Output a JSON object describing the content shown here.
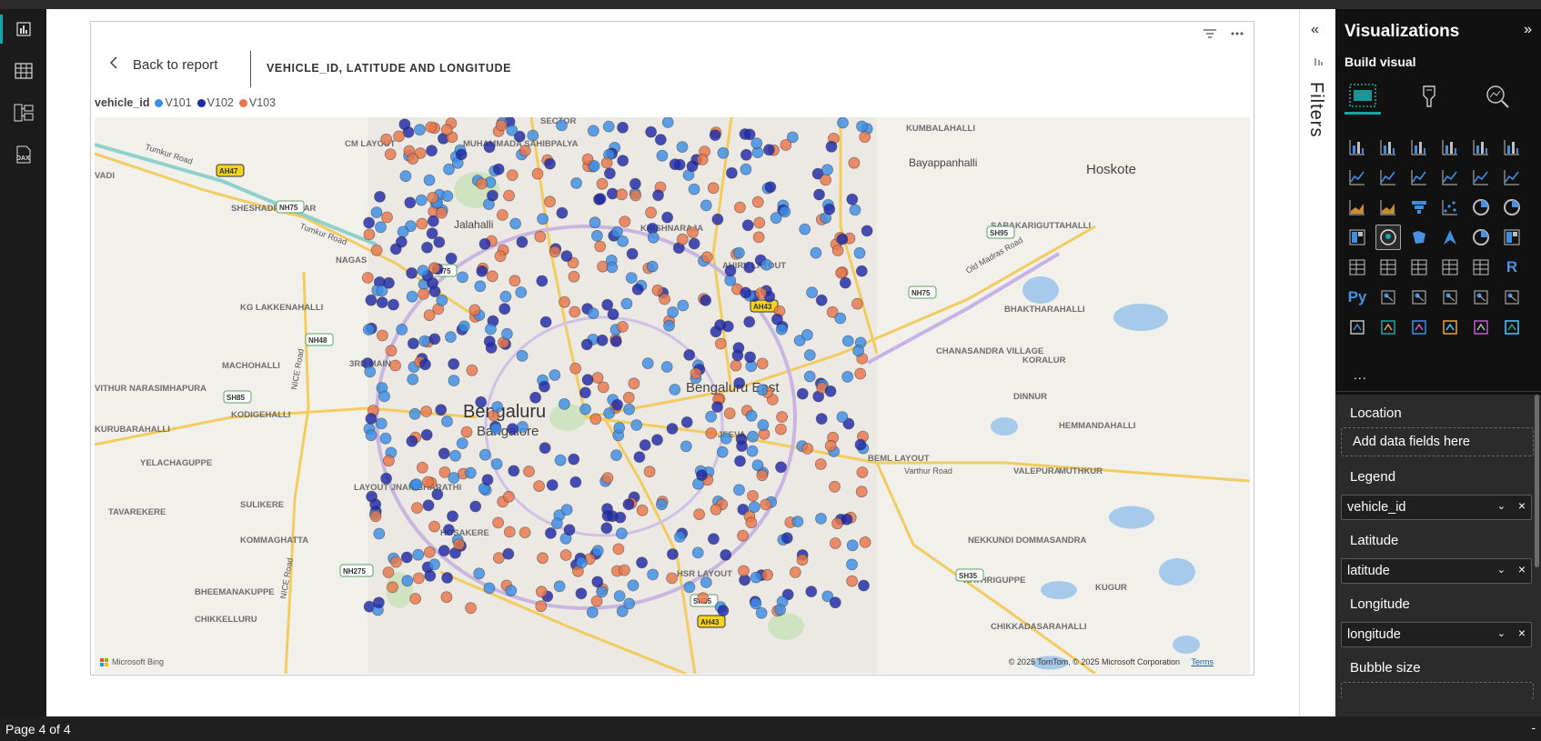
{
  "nav": {
    "items": [
      "report-view",
      "table-view",
      "model-view",
      "dax-query-view"
    ],
    "active": "report-view"
  },
  "visual": {
    "back_label": "Back to report",
    "title": "VEHICLE_ID, LATITUDE AND LONGITUDE",
    "legend_title": "vehicle_id",
    "legend": [
      {
        "label": "V101",
        "color": "#3c8de6"
      },
      {
        "label": "V102",
        "color": "#1f2aa8"
      },
      {
        "label": "V103",
        "color": "#e8764a"
      }
    ],
    "attribution": "© 2025 TomTom, © 2025 Microsoft Corporation",
    "terms": "Terms",
    "bing": "Microsoft Bing"
  },
  "map_labels": [
    {
      "text": "Bengaluru",
      "size": "big"
    },
    {
      "text": "Bangalore",
      "size": "med"
    },
    {
      "text": "Bengaluru East",
      "size": "med"
    },
    {
      "text": "Hoskote",
      "size": "med"
    },
    {
      "text": "Bayappanhalli",
      "size": "sm"
    },
    {
      "text": "Tumkur Road",
      "size": "xs"
    },
    {
      "text": "Tumkur Road",
      "size": "xs"
    },
    {
      "text": "Old Madras Road",
      "size": "xs"
    },
    {
      "text": "Varthur Road",
      "size": "xs"
    },
    {
      "text": "NICE Road",
      "size": "xs"
    },
    {
      "text": "NICE Road",
      "size": "xs"
    },
    {
      "text": "KUMBALAHALLI",
      "size": "caps"
    },
    {
      "text": "SARAKARIGUTTAHALLI",
      "size": "caps"
    },
    {
      "text": "BHAKTHARAHALLI",
      "size": "caps"
    },
    {
      "text": "CHANASANDRA VILLAGE",
      "size": "caps"
    },
    {
      "text": "KORALUR",
      "size": "caps"
    },
    {
      "text": "DINNUR",
      "size": "caps"
    },
    {
      "text": "HEMMANDAHALLI",
      "size": "caps"
    },
    {
      "text": "VALEPURA",
      "size": "caps"
    },
    {
      "text": "MUTHKUR",
      "size": "caps"
    },
    {
      "text": "NEKKUNDI DOMMASANDRA",
      "size": "caps"
    },
    {
      "text": "KATHRIGUPPE",
      "size": "caps"
    },
    {
      "text": "KUGUR",
      "size": "caps"
    },
    {
      "text": "CHIKKADASARAHALLI",
      "size": "caps"
    },
    {
      "text": "BEML LAYOUT",
      "size": "caps"
    },
    {
      "text": "VADI",
      "size": "caps"
    },
    {
      "text": "SHESHADRI NAGAR",
      "size": "caps"
    },
    {
      "text": "KG LAKKENAHALLI",
      "size": "caps"
    },
    {
      "text": "MACHOHALLI",
      "size": "caps"
    },
    {
      "text": "3RD MAIN",
      "size": "caps"
    },
    {
      "text": "VITHUR NARASIMHAPURA",
      "size": "caps"
    },
    {
      "text": "KODIGEHALLI",
      "size": "caps"
    },
    {
      "text": "KURUBARAHALLI",
      "size": "caps"
    },
    {
      "text": "YELACHAGUPPE",
      "size": "caps"
    },
    {
      "text": "SULIKERE",
      "size": "caps"
    },
    {
      "text": "TAVAREKERE",
      "size": "caps"
    },
    {
      "text": "KOMMAGHATTA",
      "size": "caps"
    },
    {
      "text": "BHEEMANAKUPPE",
      "size": "caps"
    },
    {
      "text": "CHIKKELLURU",
      "size": "caps"
    },
    {
      "text": "CM LAYOUT",
      "size": "caps"
    },
    {
      "text": "MUHAMMADA SAHIBPALYA",
      "size": "caps"
    },
    {
      "text": "SECTOR",
      "size": "caps"
    },
    {
      "text": "Jalahalli",
      "size": "sm"
    },
    {
      "text": "NAGAS",
      "size": "caps"
    },
    {
      "text": "KRISHNARAJA",
      "size": "caps"
    },
    {
      "text": "AHIRV LAYOUT",
      "size": "caps"
    },
    {
      "text": "JEEVA",
      "size": "caps"
    },
    {
      "text": "LAYOUT JNAN BHARATHI",
      "size": "caps"
    },
    {
      "text": "HOSAKERE",
      "size": "caps"
    },
    {
      "text": "HSR LAYOUT",
      "size": "caps"
    },
    {
      "text": "NH75",
      "size": "shield"
    },
    {
      "text": "NH75",
      "size": "shield"
    },
    {
      "text": "NH75",
      "size": "shield"
    },
    {
      "text": "NH48",
      "size": "shield"
    },
    {
      "text": "NH275",
      "size": "shield"
    },
    {
      "text": "SH85",
      "size": "shield"
    },
    {
      "text": "SH95",
      "size": "shield"
    },
    {
      "text": "SH35",
      "size": "shield"
    },
    {
      "text": "SH35",
      "size": "shield"
    },
    {
      "text": "AH47",
      "size": "ahshield"
    },
    {
      "text": "AH43",
      "size": "ahshield"
    },
    {
      "text": "AH43",
      "size": "ahshield"
    }
  ],
  "filters": {
    "label": "Filters"
  },
  "viz": {
    "title": "Visualizations",
    "subtitle": "Build visual",
    "more": "...",
    "wells": {
      "location": {
        "label": "Location",
        "placeholder": "Add data fields here"
      },
      "legend": {
        "label": "Legend",
        "value": "vehicle_id"
      },
      "latitude": {
        "label": "Latitude",
        "value": "latitude"
      },
      "longitude": {
        "label": "Longitude",
        "value": "longitude"
      },
      "bubble": {
        "label": "Bubble size"
      }
    }
  },
  "status": {
    "page": "Page 4 of 4",
    "right": "-"
  }
}
